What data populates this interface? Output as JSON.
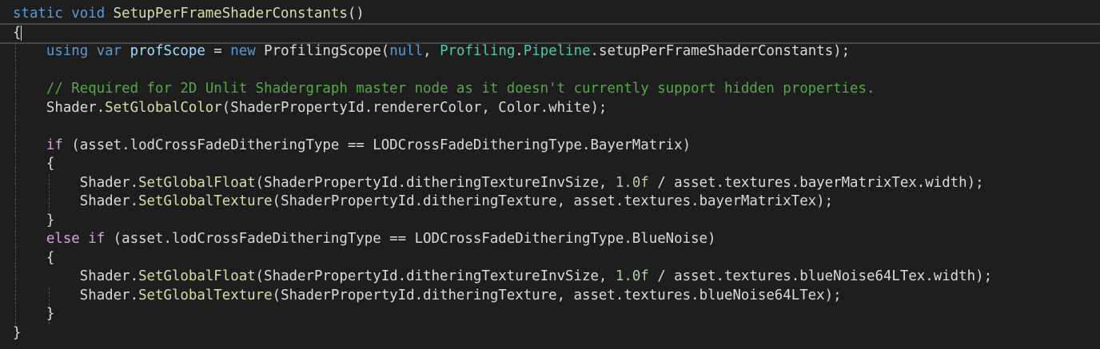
{
  "colors": {
    "background": "#1e1e1e",
    "keyword": "#569cd6",
    "method": "#dcdcaa",
    "type": "#4ec9b0",
    "comment": "#57a64a",
    "number": "#b5cea8",
    "control": "#d8a0df",
    "local": "#9cdcfe"
  },
  "lines": [
    [
      [
        "static void ",
        "kw"
      ],
      [
        "SetupPerFrameShaderConstants",
        "fn"
      ],
      [
        "()",
        "tx"
      ]
    ],
    [
      [
        "{",
        "tx"
      ]
    ],
    [
      [
        "    ",
        "tx"
      ],
      [
        "using var ",
        "kw"
      ],
      [
        "profScope",
        "loc"
      ],
      [
        " = ",
        "tx"
      ],
      [
        "new ",
        "kw"
      ],
      [
        "ProfilingScope",
        "tx"
      ],
      [
        "(",
        "tx"
      ],
      [
        "null",
        "kw"
      ],
      [
        ", ",
        "tx"
      ],
      [
        "Profiling",
        "ty"
      ],
      [
        ".",
        "tx"
      ],
      [
        "Pipeline",
        "ty"
      ],
      [
        ".setupPerFrameShaderConstants);",
        "tx"
      ]
    ],
    [],
    [
      [
        "    ",
        "tx"
      ],
      [
        "// Required for 2D Unlit Shadergraph master node as it doesn't currently support hidden properties.",
        "cm"
      ]
    ],
    [
      [
        "    Shader.",
        "tx"
      ],
      [
        "SetGlobalColor",
        "fn"
      ],
      [
        "(ShaderPropertyId.rendererColor, Color.white);",
        "tx"
      ]
    ],
    [],
    [
      [
        "    ",
        "tx"
      ],
      [
        "if",
        "ctl"
      ],
      [
        " (asset.lodCrossFadeDitheringType == LODCrossFadeDitheringType.BayerMatrix)",
        "tx"
      ]
    ],
    [
      [
        "    {",
        "tx"
      ]
    ],
    [
      [
        "        Shader.",
        "tx"
      ],
      [
        "SetGlobalFloat",
        "fn"
      ],
      [
        "(ShaderPropertyId.ditheringTextureInvSize, ",
        "tx"
      ],
      [
        "1.0f",
        "nm"
      ],
      [
        " / asset.textures.bayerMatrixTex.width);",
        "tx"
      ]
    ],
    [
      [
        "        Shader.",
        "tx"
      ],
      [
        "SetGlobalTexture",
        "fn"
      ],
      [
        "(ShaderPropertyId.ditheringTexture, asset.textures.bayerMatrixTex);",
        "tx"
      ]
    ],
    [
      [
        "    }",
        "tx"
      ]
    ],
    [
      [
        "    ",
        "tx"
      ],
      [
        "else if",
        "ctl"
      ],
      [
        " (asset.lodCrossFadeDitheringType == LODCrossFadeDitheringType.BlueNoise)",
        "tx"
      ]
    ],
    [
      [
        "    {",
        "tx"
      ]
    ],
    [
      [
        "        Shader.",
        "tx"
      ],
      [
        "SetGlobalFloat",
        "fn"
      ],
      [
        "(ShaderPropertyId.ditheringTextureInvSize, ",
        "tx"
      ],
      [
        "1.0f",
        "nm"
      ],
      [
        " / asset.textures.blueNoise64LTex.width);",
        "tx"
      ]
    ],
    [
      [
        "        Shader.",
        "tx"
      ],
      [
        "SetGlobalTexture",
        "fn"
      ],
      [
        "(ShaderPropertyId.ditheringTexture, asset.textures.blueNoise64LTex);",
        "tx"
      ]
    ],
    [
      [
        "    }",
        "tx"
      ]
    ],
    [
      [
        "}",
        "tx"
      ]
    ]
  ]
}
